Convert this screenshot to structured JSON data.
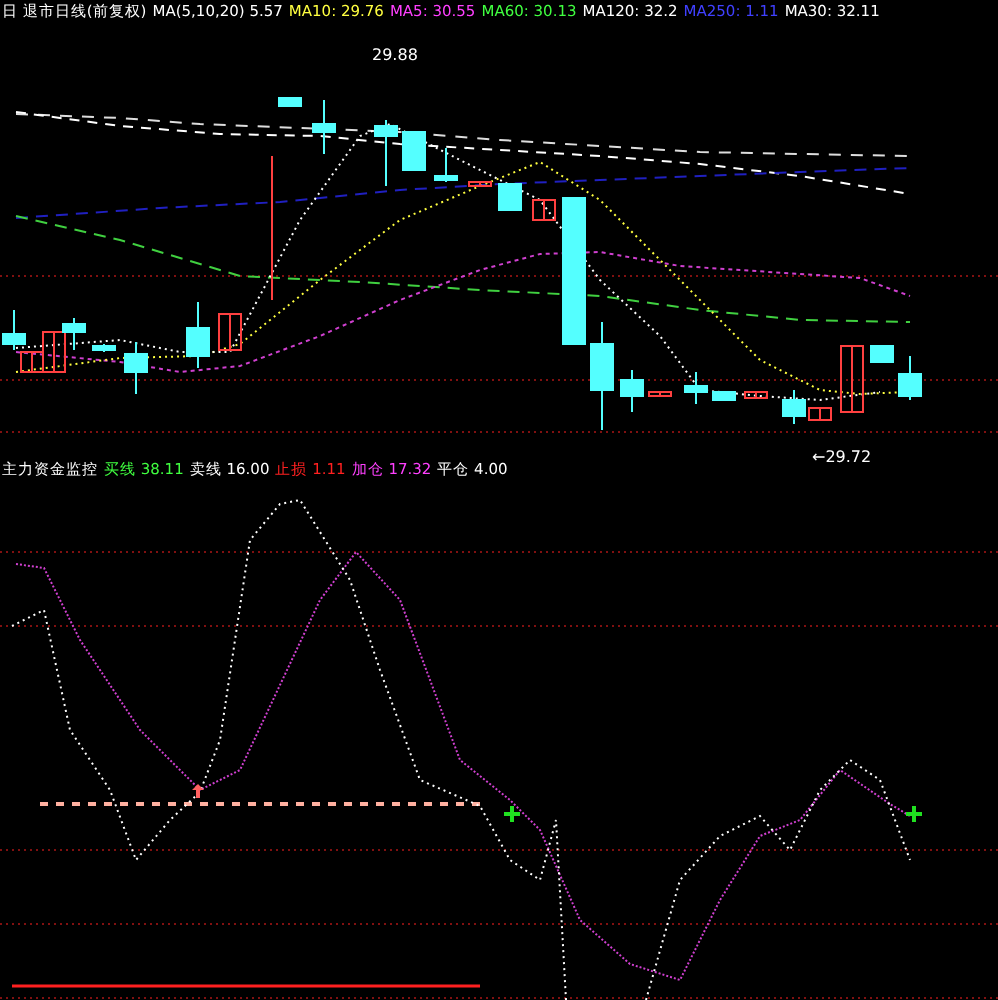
{
  "header": {
    "items": [
      {
        "text": "日 退市日线(前复权)",
        "color": "#ffffff"
      },
      {
        "text": "MA(5,10,20) 5.57",
        "color": "#ffffff"
      },
      {
        "text": "MA10: 29.76",
        "color": "#ffff40"
      },
      {
        "text": "MA5: 30.55",
        "color": "#ff40ff"
      },
      {
        "text": "MA60: 30.13",
        "color": "#40ff40"
      },
      {
        "text": "MA120: 32.2",
        "color": "#ffffff"
      },
      {
        "text": "MA250: 1.11",
        "color": "#4040ff"
      },
      {
        "text": "MA30: 32.11",
        "color": "#ffffff"
      }
    ]
  },
  "price_pane": {
    "labels": [
      {
        "text": "29.88"
      },
      {
        "text": "←29.72"
      }
    ]
  },
  "indicator_header": {
    "items": [
      {
        "text": "主力资金监控",
        "color": "#ffffff"
      },
      {
        "text": "买线 38.11",
        "color": "#40ff40"
      },
      {
        "text": "卖线 16.00",
        "color": "#ffffff"
      },
      {
        "text": "止损 1.11",
        "color": "#ff2020"
      },
      {
        "text": "加仓 17.32",
        "color": "#ff40ff"
      },
      {
        "text": "平仓 4.00",
        "color": "#ffffff"
      }
    ]
  }
}
